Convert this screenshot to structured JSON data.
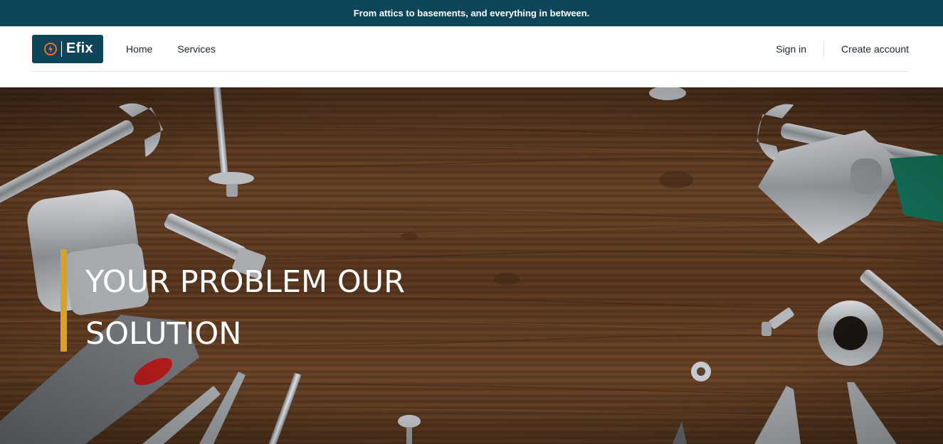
{
  "announcement": {
    "text": "From attics to basements, and everything in between."
  },
  "header": {
    "logo": {
      "text": "Efix",
      "icon": "lightning-bolt-icon"
    },
    "nav": [
      {
        "label": "Home"
      },
      {
        "label": "Services"
      }
    ],
    "account": {
      "sign_in": "Sign in",
      "create_account": "Create account"
    }
  },
  "hero": {
    "headline": "YOUR PROBLEM OUR SOLUTION",
    "accent_color": "#d8a22a",
    "background": "wooden-table-with-tools-photo"
  },
  "colors": {
    "brand": "#0e4558",
    "accent": "#d8a22a"
  }
}
